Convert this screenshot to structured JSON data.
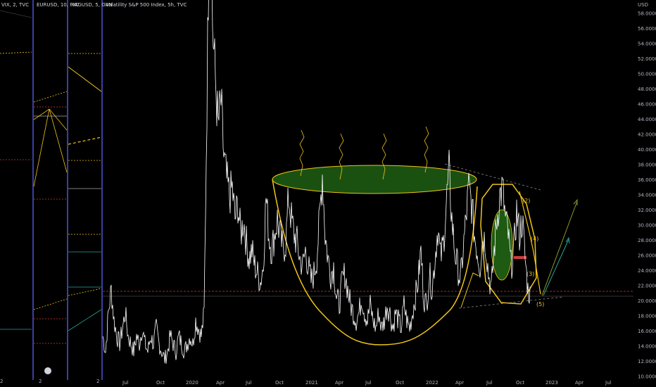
{
  "panes": [
    {
      "title": "VIX, 2, TVC",
      "axis_label": "2"
    },
    {
      "title": "EURUSD, 10, FXC",
      "axis_label": "2"
    },
    {
      "title": "XAGUSD, 5, OAN",
      "axis_label": "2"
    },
    {
      "title": "Volatility S&P 500 Index, 5h, TVC"
    }
  ],
  "chart_data": {
    "type": "line",
    "title": "Volatility S&P 500 Index, 5h, TVC",
    "currency": "USD",
    "y_ticks": [
      "58.0000",
      "56.0000",
      "54.0000",
      "52.0000",
      "50.0000",
      "48.0000",
      "46.0000",
      "44.0000",
      "42.0000",
      "40.0000",
      "38.0000",
      "36.0000",
      "34.0000",
      "32.0000",
      "30.0000",
      "28.0000",
      "26.0000",
      "24.0000",
      "22.0000",
      "20.0000",
      "18.0000",
      "16.0000",
      "14.0000",
      "12.0000",
      "10.0000"
    ],
    "ylim": [
      9.6,
      59.8
    ],
    "x_ticks": [
      "Jul",
      "Oct",
      "2020",
      "Apr",
      "Jul",
      "Oct",
      "2021",
      "Apr",
      "Jul",
      "Oct",
      "2022",
      "Apr",
      "Jul",
      "Oct",
      "2023",
      "Apr",
      "Jul"
    ],
    "series": [
      {
        "values": [
          [
            0,
            15
          ],
          [
            4,
            13
          ],
          [
            8,
            18
          ],
          [
            12,
            21
          ],
          [
            16,
            17
          ],
          [
            20,
            15
          ],
          [
            24,
            14
          ],
          [
            28,
            16
          ],
          [
            32,
            18
          ],
          [
            36,
            15
          ],
          [
            40,
            14
          ],
          [
            44,
            13
          ],
          [
            48,
            15
          ],
          [
            52,
            14
          ],
          [
            56,
            16
          ],
          [
            60,
            14
          ],
          [
            64,
            13
          ],
          [
            68,
            15
          ],
          [
            72,
            14
          ],
          [
            76,
            16
          ],
          [
            80,
            14
          ],
          [
            84,
            13
          ],
          [
            88,
            12
          ],
          [
            92,
            13
          ],
          [
            96,
            15
          ],
          [
            100,
            14
          ],
          [
            104,
            13
          ],
          [
            108,
            15
          ],
          [
            112,
            14
          ],
          [
            116,
            13
          ],
          [
            120,
            14
          ],
          [
            124,
            15
          ],
          [
            128,
            14
          ],
          [
            132,
            17
          ],
          [
            136,
            16
          ],
          [
            140,
            15
          ],
          [
            144,
            18
          ],
          [
            148,
            45
          ],
          [
            152,
            75
          ],
          [
            156,
            55
          ],
          [
            160,
            48
          ],
          [
            164,
            42
          ],
          [
            168,
            45
          ],
          [
            172,
            38
          ],
          [
            176,
            35
          ],
          [
            180,
            33
          ],
          [
            184,
            34
          ],
          [
            188,
            30
          ],
          [
            192,
            32
          ],
          [
            196,
            28
          ],
          [
            200,
            30
          ],
          [
            204,
            27
          ],
          [
            208,
            25
          ],
          [
            212,
            26
          ],
          [
            216,
            24
          ],
          [
            220,
            23
          ],
          [
            224,
            22
          ],
          [
            228,
            24
          ],
          [
            232,
            33
          ],
          [
            236,
            28
          ],
          [
            240,
            26
          ],
          [
            244,
            28
          ],
          [
            248,
            30
          ],
          [
            252,
            28
          ],
          [
            256,
            26
          ],
          [
            260,
            27
          ],
          [
            264,
            33
          ],
          [
            268,
            30
          ],
          [
            272,
            28
          ],
          [
            276,
            27
          ],
          [
            280,
            25
          ],
          [
            284,
            24
          ],
          [
            288,
            26
          ],
          [
            292,
            24
          ],
          [
            296,
            22
          ],
          [
            300,
            23
          ],
          [
            304,
            25
          ],
          [
            308,
            30
          ],
          [
            312,
            36
          ],
          [
            316,
            28
          ],
          [
            320,
            25
          ],
          [
            324,
            23
          ],
          [
            328,
            24
          ],
          [
            332,
            20
          ],
          [
            336,
            19
          ],
          [
            340,
            22
          ],
          [
            344,
            23
          ],
          [
            348,
            21
          ],
          [
            352,
            19
          ],
          [
            356,
            18
          ],
          [
            360,
            17
          ],
          [
            364,
            18
          ],
          [
            368,
            20
          ],
          [
            372,
            18
          ],
          [
            376,
            17
          ],
          [
            380,
            19
          ],
          [
            384,
            17
          ],
          [
            388,
            16
          ],
          [
            392,
            18
          ],
          [
            396,
            16
          ],
          [
            400,
            17
          ],
          [
            404,
            19
          ],
          [
            408,
            18
          ],
          [
            412,
            16
          ],
          [
            416,
            18
          ],
          [
            420,
            17
          ],
          [
            424,
            16
          ],
          [
            428,
            19
          ],
          [
            432,
            17
          ],
          [
            436,
            16
          ],
          [
            440,
            18
          ],
          [
            444,
            20
          ],
          [
            448,
            22
          ],
          [
            452,
            26
          ],
          [
            456,
            20
          ],
          [
            460,
            19
          ],
          [
            464,
            23
          ],
          [
            468,
            21
          ],
          [
            472,
            25
          ],
          [
            476,
            29
          ],
          [
            480,
            25
          ],
          [
            484,
            27
          ],
          [
            488,
            32
          ],
          [
            492,
            36
          ],
          [
            496,
            30
          ],
          [
            500,
            26
          ],
          [
            504,
            24
          ],
          [
            508,
            22
          ],
          [
            512,
            26
          ],
          [
            516,
            30
          ],
          [
            520,
            34
          ],
          [
            524,
            32
          ],
          [
            528,
            28
          ],
          [
            532,
            26
          ],
          [
            536,
            24
          ],
          [
            540,
            28
          ],
          [
            544,
            27
          ],
          [
            548,
            23
          ],
          [
            552,
            21
          ],
          [
            556,
            26
          ],
          [
            560,
            30
          ],
          [
            564,
            33
          ],
          [
            568,
            34
          ],
          [
            572,
            30
          ],
          [
            576,
            28
          ],
          [
            580,
            24
          ],
          [
            584,
            26
          ],
          [
            588,
            31
          ],
          [
            592,
            28
          ],
          [
            596,
            30
          ],
          [
            600,
            25
          ],
          [
            604,
            21
          ],
          [
            608,
            20
          ]
        ]
      }
    ],
    "annotations": [
      "(2)",
      "(4)",
      "(3)",
      "(5)"
    ],
    "grid": false
  },
  "colors": {
    "background": "#000000",
    "price_line": "#ffffff",
    "drawing_yellow": "#f0c419",
    "cup_fill": "#1e5a12",
    "pane_border": "#3a3f9e",
    "dashed_red": "#d23c3c",
    "arrow_green": "#26a69a",
    "axis_text": "#b2b5be"
  }
}
